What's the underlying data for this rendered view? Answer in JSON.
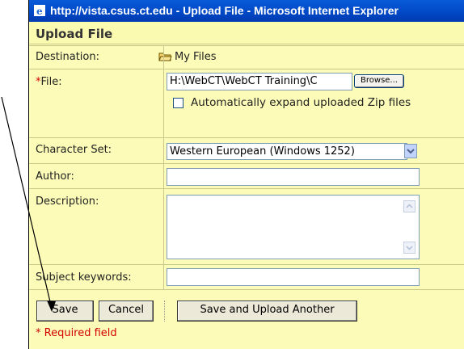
{
  "window": {
    "title": "http://vista.csus.ct.edu - Upload File - Microsoft Internet Explorer"
  },
  "form": {
    "heading": "Upload File",
    "destination": {
      "label": "Destination:",
      "value": "My Files"
    },
    "file": {
      "required_mark": "*",
      "label": "File:",
      "value": "H:\\WebCT\\WebCT Training\\C",
      "browse_label": "Browse..."
    },
    "auto_expand": {
      "label": "Automatically expand uploaded Zip files",
      "checked": false
    },
    "charset": {
      "label": "Character Set:",
      "value": "Western European (Windows 1252)"
    },
    "author": {
      "label": "Author:",
      "value": ""
    },
    "description": {
      "label": "Description:",
      "value": ""
    },
    "keywords": {
      "label": "Subject keywords:",
      "value": ""
    },
    "buttons": {
      "save": "Save",
      "cancel": "Cancel",
      "save_upload_another": "Save and Upload Another"
    },
    "required_note": "* Required field"
  },
  "colors": {
    "form_bg": "#fcfcb8",
    "titlebar": "#0047c4",
    "required": "#d40000"
  }
}
